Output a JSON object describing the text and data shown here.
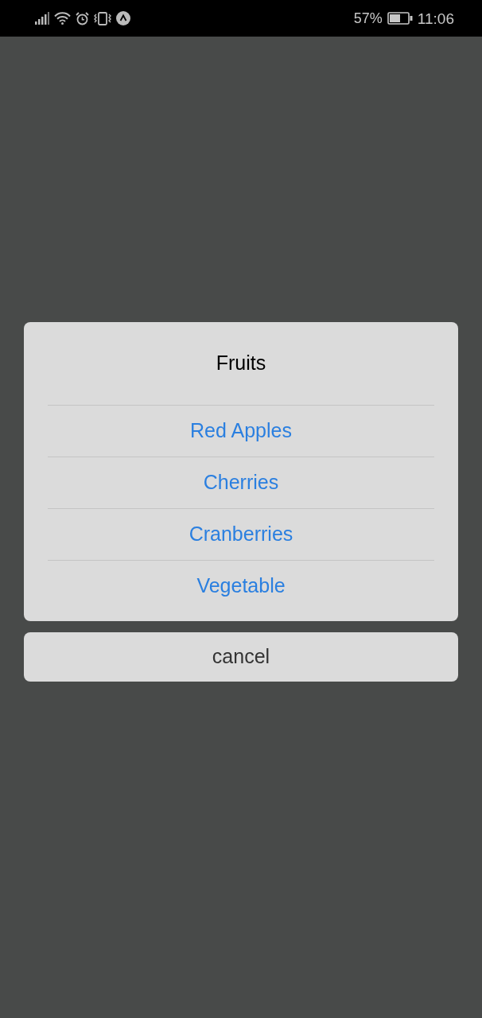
{
  "status_bar": {
    "battery_percent": "57%",
    "time": "11:06"
  },
  "action_sheet": {
    "title": "Fruits",
    "options": [
      {
        "label": "Red Apples"
      },
      {
        "label": "Cherries"
      },
      {
        "label": "Cranberries"
      },
      {
        "label": "Vegetable"
      }
    ]
  },
  "cancel_button": {
    "label": "cancel"
  }
}
